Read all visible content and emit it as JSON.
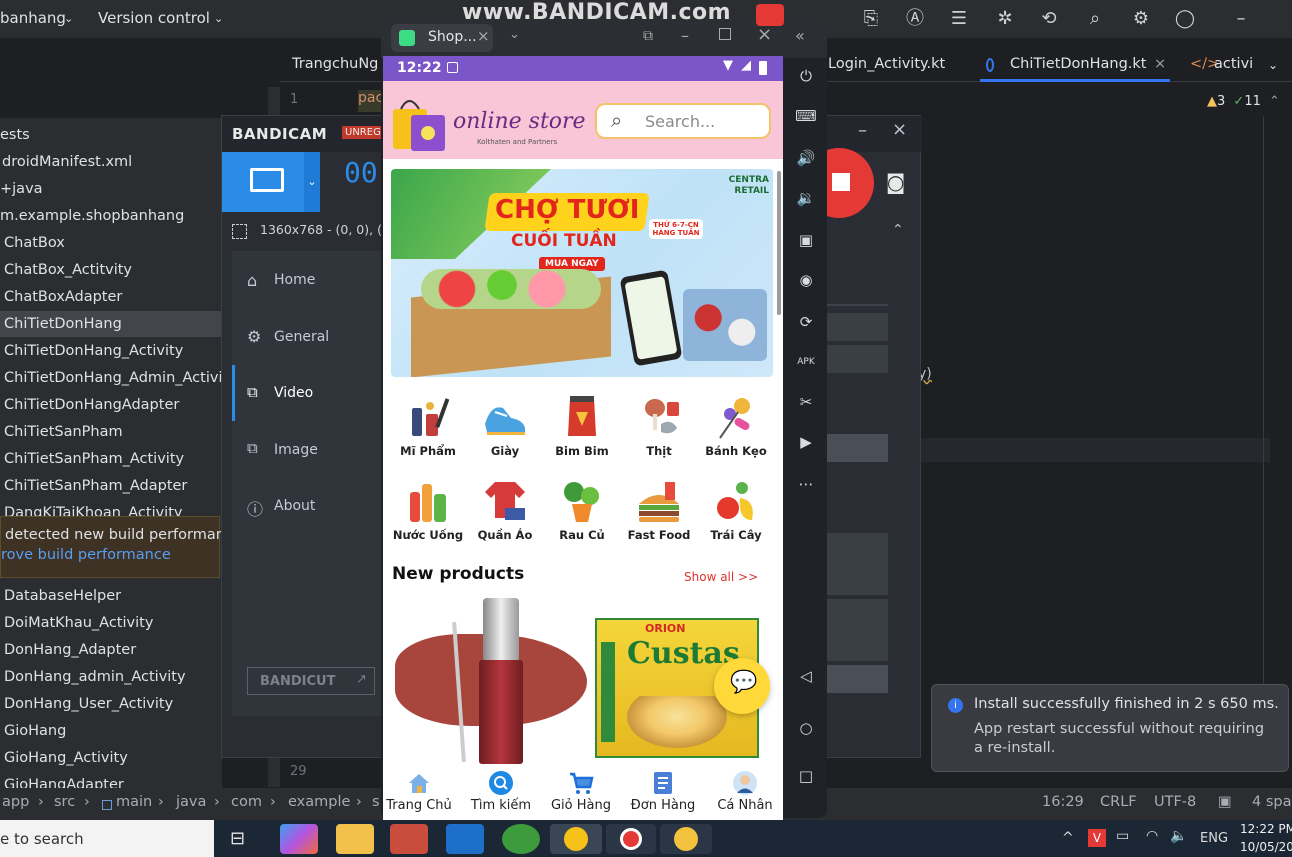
{
  "watermark": "www.BANDICAM.com",
  "ide": {
    "top_menu": [
      "banhang",
      "Version control"
    ],
    "tabs": [
      "TrangchuNg",
      "Login_Activity.kt",
      "ChiTietDonHang.kt",
      "activi"
    ],
    "line_numbers": [
      "1",
      "29"
    ],
    "code_snippet": "pac",
    "code_fragment": "y)",
    "inspections": {
      "warnings": "3",
      "checks": "11"
    },
    "project_tree": [
      "ests",
      "droidManifest.xml",
      "+java",
      "m.example.shopbanhang",
      "ChatBox",
      "ChatBox_Actitvity",
      "ChatBoxAdapter",
      "ChiTietDonHang",
      "ChiTietDonHang_Activity",
      "ChiTietDonHang_Admin_Activit",
      "ChiTietDonHangAdapter",
      "ChiTietSanPham",
      "ChiTietSanPham_Activity",
      "ChiTietSanPham_Adapter",
      "DangKiTaiKhoan_Activity"
    ],
    "project_tree_lower": [
      "DatabaseHelper",
      "DoiMatKhau_Activity",
      "DonHang_Adapter",
      "DonHang_admin_Activity",
      "DonHang_User_Activity",
      "GioHang",
      "GioHang_Activity",
      "GioHangAdapter"
    ],
    "warning": {
      "line1": "detected new build performan",
      "line2": "rove build performance"
    },
    "breadcrumb": [
      "app",
      "src",
      "main",
      "java",
      "com",
      "example",
      "s"
    ],
    "status": {
      "position": "16:29",
      "line_sep": "CRLF",
      "encoding": "UTF-8",
      "indent": "4 spa"
    },
    "notification": {
      "title": "Install successfully finished in 2 s 650 ms.",
      "body": "App restart successful without requiring a re-install."
    },
    "colors": {
      "bg": "#1e1f22",
      "panel": "#2b2d30",
      "accent": "#3574f0"
    }
  },
  "bandicam": {
    "logo": "BANDICAM",
    "badge": "UNREGI",
    "counter": "00",
    "resolution": "1360x768 - (0, 0), (13",
    "nav": [
      "Home",
      "General",
      "Video",
      "Image",
      "About"
    ],
    "active_nav": "Video",
    "bandicut": "BANDICUT",
    "colors": {
      "record": "#e53935",
      "accent": "#2b8ce8"
    }
  },
  "emulator": {
    "tab_title": "Shop...",
    "time": "12:22",
    "store": {
      "name": "online store",
      "tagline": "Kolthaten and Partners"
    },
    "search_placeholder": "Search...",
    "banner": {
      "corner": "CENTRA RETAIL",
      "title1": "CHỢ TƯƠI",
      "title2": "CUỐI TUẦN",
      "cta": "MUA NGAY",
      "tag": "THỨ 6-7-CN HÀNG TUẦN"
    },
    "categories": [
      {
        "label": "Mĩ Phẩm",
        "icon": "cosmetics-icon"
      },
      {
        "label": "Giày",
        "icon": "shoe-icon"
      },
      {
        "label": "Bim Bim",
        "icon": "snack-icon"
      },
      {
        "label": "Thịt",
        "icon": "meat-icon"
      },
      {
        "label": "Bánh Kẹo",
        "icon": "candy-icon"
      },
      {
        "label": "Nước Uống",
        "icon": "drinks-icon"
      },
      {
        "label": "Quần Áo",
        "icon": "clothes-icon"
      },
      {
        "label": "Rau Củ",
        "icon": "vegetables-icon"
      },
      {
        "label": "Fast Food",
        "icon": "fastfood-icon"
      },
      {
        "label": "Trái Cây",
        "icon": "fruit-icon"
      }
    ],
    "new_products": {
      "title": "New products",
      "show_all": "Show all >>"
    },
    "products": [
      {
        "name": "lip tint",
        "icon": "lipstick-image"
      },
      {
        "name": "ORION Custas",
        "brand": "ORION",
        "text": "Custas"
      }
    ],
    "bottom_nav": [
      "Trang Chủ",
      "Tìm kiếm",
      "Giỏ Hàng",
      "Đơn Hàng",
      "Cá Nhân"
    ]
  },
  "taskbar": {
    "search_text": "e to search",
    "lang": "ENG",
    "clock_time": "12:22 PM",
    "clock_date": "10/05/20"
  }
}
